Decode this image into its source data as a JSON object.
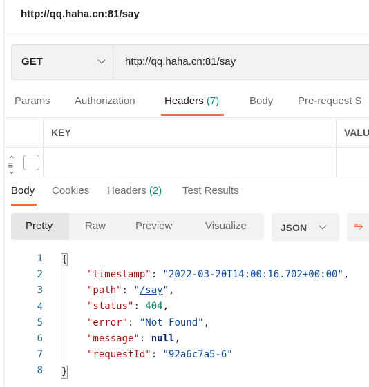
{
  "request": {
    "title": "http://qq.haha.cn:81/say",
    "method": "GET",
    "url": "http://qq.haha.cn:81/say"
  },
  "request_tabs": [
    {
      "label": "Params"
    },
    {
      "label": "Authorization"
    },
    {
      "label": "Headers",
      "count": "(7)",
      "active": true
    },
    {
      "label": "Body"
    },
    {
      "label": "Pre-request S"
    }
  ],
  "headers_table": {
    "columns": [
      "KEY",
      "VALU"
    ],
    "rows": [
      {
        "key": "",
        "value": "",
        "checked": false
      }
    ]
  },
  "response_tabs": [
    {
      "label": "Body",
      "active": true
    },
    {
      "label": "Cookies"
    },
    {
      "label": "Headers",
      "count": "(2)"
    },
    {
      "label": "Test Results"
    }
  ],
  "view_modes": [
    "Pretty",
    "Raw",
    "Preview",
    "Visualize"
  ],
  "selected_view": "Pretty",
  "format": "JSON",
  "icons": {
    "wrap": "wrap-lines-icon",
    "drag": "drag-handle-icon",
    "chevron": "chevron-down-icon"
  },
  "colors": {
    "accent": "#f26b3a",
    "count": "#0c8a78"
  },
  "body": {
    "line_numbers": [
      "1",
      "2",
      "3",
      "4",
      "5",
      "6",
      "7",
      "8"
    ],
    "open": "{",
    "close": "}",
    "lines": [
      {
        "key": "\"timestamp\"",
        "value": "\"2022-03-20T14:00:16.702+00:00\"",
        "type": "s",
        "comma": ","
      },
      {
        "key": "\"path\"",
        "value": "/say",
        "type": "link",
        "comma": ","
      },
      {
        "key": "\"status\"",
        "value": "404",
        "type": "n",
        "comma": ","
      },
      {
        "key": "\"error\"",
        "value": "\"Not Found\"",
        "type": "s",
        "comma": ","
      },
      {
        "key": "\"message\"",
        "value": "null",
        "type": "null",
        "comma": ","
      },
      {
        "key": "\"requestId\"",
        "value": "\"92a6c7a5-6\"",
        "type": "s",
        "comma": ""
      }
    ]
  }
}
